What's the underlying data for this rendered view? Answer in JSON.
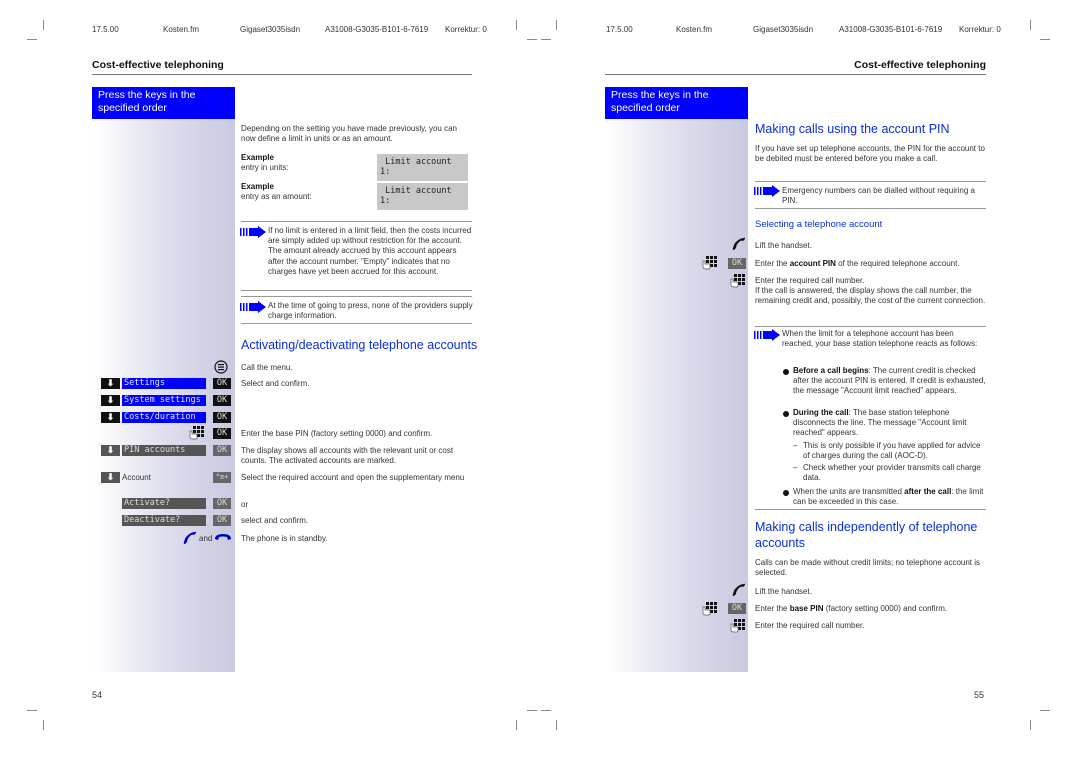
{
  "header": {
    "date": "17.5.00",
    "file": "Kosten.fm",
    "product": "Gigaset3035isdn",
    "doc_id": "A31008-G3035-B101-6-7619",
    "korrektur": "Korrektur: 0"
  },
  "left_page": {
    "section_title": "Cost-effective telephoning",
    "sidebar_heading": "Press the keys in the specified order",
    "intro": "Depending on the setting you have made previously, you can now define a limit in units or as an amount.",
    "examples": [
      {
        "label": "Example",
        "sub": "entry in units:",
        "lcd_line1": " Limit account",
        "lcd_line2": "1:"
      },
      {
        "label": "Example",
        "sub": "entry as an amount:",
        "lcd_line1": " Limit account",
        "lcd_line2": "1:"
      }
    ],
    "notes": [
      "If no limit is entered in a limit field, then the costs incurred are simply added up without restriction for the account. The amount already accrued by this account appears after the account number. \"Empty\" indicates that no charges have yet been accrued for this account.",
      "At the time of going to press, none of the providers supply charge information."
    ],
    "heading": "Activating/deactivating telephone accounts",
    "steps": {
      "call_menu": "Call the menu.",
      "select_confirm": "Select and confirm.",
      "enter_pin": "Enter the base PIN (factory setting 0000) and confirm.",
      "display_shows": "The display shows all accounts with the relevant unit or cost counts. The activated accounts are marked.",
      "select_account": "Select the required account and open the supplementary menu",
      "or": "or",
      "select_and_confirm": "select and confirm.",
      "standby": "The phone is in standby."
    },
    "keys": {
      "menu_items": [
        "Settings",
        "System settings",
        "Costs/duration"
      ],
      "pin_accounts": "PIN accounts",
      "account": "Account",
      "activate": "Activate?",
      "deactivate": "Deactivate?",
      "ok": "OK",
      "and": "and"
    },
    "page_number": "54"
  },
  "right_page": {
    "section_title": "Cost-effective telephoning",
    "sidebar_heading": "Press the keys in the specified order",
    "heading1": "Making calls using the account PIN",
    "intro": "If you have set up telephone accounts, the PIN for the account to be debited must be entered before you make a call.",
    "note1": "Emergency numbers can be dialled without requiring a PIN.",
    "subheading": "Selecting a telephone account",
    "steps1": {
      "lift": "Lift the handset.",
      "enter_pin_pre": "Enter the ",
      "enter_pin_bold": "account PIN",
      "enter_pin_post": " of the required telephone account.",
      "enter_number": "Enter the required call number.",
      "answered": "If the call is answered, the display shows the call number, the remaining credit and, possibly, the cost of the current connection."
    },
    "note2": "When the limit for a telephone account has been reached, your base station telephone reacts as follows:",
    "bullets": [
      {
        "bold": "Before a call begins",
        "text": ": The current credit is checked after the account PIN is entered. If credit is exhausted, the message \"Account limit reached\" appears."
      },
      {
        "bold": "During the call",
        "text": ": The base station telephone disconnects the line. The message \"Account limit reached\" appears."
      }
    ],
    "dashes": [
      "This is only possible if you have applied for advice of charges during the call (AOC-D).",
      "Check whether your provider transmits call charge data."
    ],
    "bullet3_pre": "When the units are transmitted ",
    "bullet3_bold": "after the call",
    "bullet3_post": ": the limit can be exceeded in this case.",
    "heading2": "Making calls independently of telephone accounts",
    "intro2": "Calls can be made without credit limits; no telephone account is selected.",
    "steps2": {
      "lift": "Lift the handset.",
      "enter_pin_pre": "Enter the ",
      "enter_pin_bold": "base PIN",
      "enter_pin_post": " (factory setting 0000) and confirm.",
      "enter_number": "Enter the required call number."
    },
    "ok": "OK",
    "page_number": "55"
  },
  "colors": {
    "accent_blue": "#0000ff",
    "heading_blue": "#0b2ed8",
    "lcd_grey": "#c8c8c8"
  }
}
